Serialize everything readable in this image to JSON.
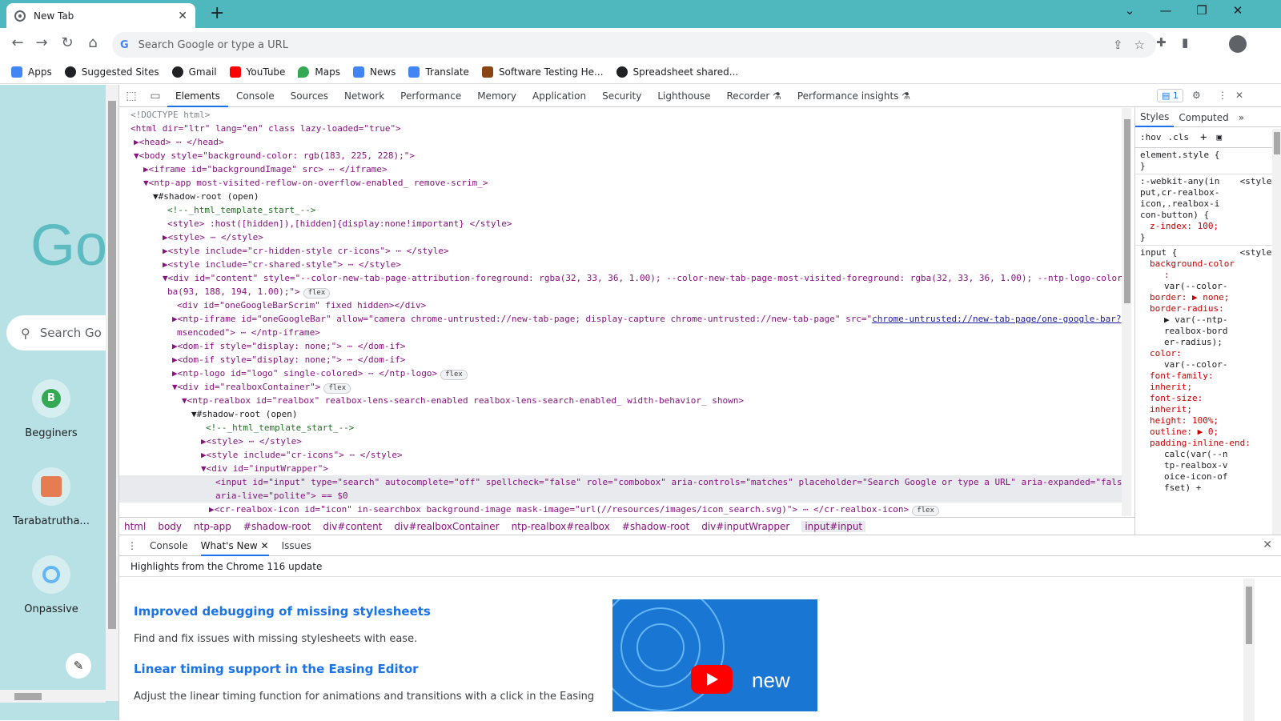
{
  "browser": {
    "tab_title": "New Tab",
    "omnibox_placeholder": "Search Google or type a URL",
    "bookmarks": [
      {
        "label": "Apps",
        "icon": "apps-grid-icon",
        "color": "#4285f4"
      },
      {
        "label": "Suggested Sites",
        "icon": "globe-icon",
        "color": "#202124"
      },
      {
        "label": "Gmail",
        "icon": "globe-icon",
        "color": "#202124"
      },
      {
        "label": "YouTube",
        "icon": "youtube-icon",
        "color": "#ff0000"
      },
      {
        "label": "Maps",
        "icon": "maps-pin-icon",
        "color": "#34a853"
      },
      {
        "label": "News",
        "icon": "news-icon",
        "color": "#4285f4"
      },
      {
        "label": "Translate",
        "icon": "translate-icon",
        "color": "#4285f4"
      },
      {
        "label": "Software Testing He...",
        "icon": "site-icon",
        "color": "#8b4513"
      },
      {
        "label": "Spreadsheet shared...",
        "icon": "globe-icon",
        "color": "#202124"
      }
    ]
  },
  "ntp": {
    "logo_fragment": "Go",
    "search_placeholder": "Search Go",
    "tiles": [
      {
        "label": "Begginers",
        "icon_letter": "B",
        "color": "#34a853"
      },
      {
        "label": "Tarabatrutha...",
        "icon_letter": "",
        "color": "#e67c52"
      },
      {
        "label": "Onpassive",
        "icon_letter": "",
        "color": "#64b5f6"
      }
    ]
  },
  "devtools": {
    "tabs": [
      "Elements",
      "Console",
      "Sources",
      "Network",
      "Performance",
      "Memory",
      "Application",
      "Security",
      "Lighthouse",
      "Recorder ⚗",
      "Performance insights ⚗"
    ],
    "issues_count": "1",
    "dom_lines": [
      {
        "text": "<!DOCTYPE html>"
      },
      {
        "text": "<html dir=\"ltr\" lang=\"en\" class lazy-loaded=\"true\">"
      },
      {
        "text": "▶<head> ⋯ </head>"
      },
      {
        "text": "▼<body style=\"background-color: rgb(183, 225, 228);\">"
      },
      {
        "text": "▶<iframe id=\"backgroundImage\" src> ⋯ </iframe>"
      },
      {
        "text": "▼<ntp-app most-visited-reflow-on-overflow-enabled_ remove-scrim_>"
      },
      {
        "text": "▼#shadow-root (open)"
      },
      {
        "text": "<!--_html_template_start_-->"
      },
      {
        "text": "<style> :host([hidden]),[hidden]{display:none!important} </style>"
      },
      {
        "text": "▶<style> ⋯ </style>"
      },
      {
        "text": "▶<style include=\"cr-hidden-style cr-icons\"> ⋯ </style>"
      },
      {
        "text": "▶<style include=\"cr-shared-style\"> ⋯ </style>"
      },
      {
        "text": "▼<div id=\"content\" style=\"--color-new-tab-page-attribution-foreground: rgba(32, 33, 36, 1.00); --color-new-tab-page-most-visited-foreground: rgba(32, 33, 36, 1.00); --ntp-logo-color: rg"
      },
      {
        "text": "ba(93, 188, 194, 1.00);\">"
      },
      {
        "text": "<div id=\"oneGoogleBarScrim\" fixed hidden></div>"
      },
      {
        "text": "▶<ntp-iframe id=\"oneGoogleBar\" allow=\"camera chrome-untrusted://new-tab-page; display-capture chrome-untrusted://new-tab-page\" src=\""
      },
      {
        "text": "msencoded\"> ⋯ </ntp-iframe>"
      },
      {
        "text": "▶<dom-if style=\"display: none;\"> ⋯ </dom-if>"
      },
      {
        "text": "▶<dom-if style=\"display: none;\"> ⋯ </dom-if>"
      },
      {
        "text": "▶<ntp-logo id=\"logo\" single-colored> ⋯ </ntp-logo>"
      },
      {
        "text": "▼<div id=\"realboxContainer\">"
      },
      {
        "text": "▼<ntp-realbox id=\"realbox\" realbox-lens-search-enabled realbox-lens-search-enabled_ width-behavior_ shown>"
      },
      {
        "text": "▼#shadow-root (open)"
      },
      {
        "text": "<!--_html_template_start_-->"
      },
      {
        "text": "▶<style> ⋯ </style>"
      },
      {
        "text": "▶<style include=\"cr-icons\"> ⋯ </style>"
      },
      {
        "text": "▼<div id=\"inputWrapper\">"
      },
      {
        "text": "<input id=\"input\" type=\"search\" autocomplete=\"off\" spellcheck=\"false\" role=\"combobox\" aria-controls=\"matches\" placeholder=\"Search Google or type a URL\" aria-expanded=\"false\""
      },
      {
        "text": "aria-live=\"polite\"> == $0"
      },
      {
        "text": "▶<cr-realbox-icon id=\"icon\" in-searchbox background-image mask-image=\"url(//resources/images/icon_search.svg)\"> ⋯ </cr-realbox-icon>"
      }
    ],
    "iframe_link": "chrome-untrusted://new-tab-page/one-google-bar?para",
    "flex_badge": "flex",
    "breadcrumbs": [
      "html",
      "body",
      "ntp-app",
      "#shadow-root",
      "div#content",
      "div#realboxContainer",
      "ntp-realbox#realbox",
      "#shadow-root",
      "div#inputWrapper",
      "input#input"
    ],
    "styles": {
      "tabs": [
        "Styles",
        "Computed"
      ],
      "filter_hov": ":hov",
      "filter_cls": ".cls",
      "element_style": "element.style {",
      "close_brace": "}",
      "rule1_selector": ":-webkit-any(input,cr-realbox-icon,.realbox-icon-button) {",
      "rule1_source": "<style>",
      "rule1_prop": "z-index: 100;",
      "rule2_selector": "input {",
      "rule2_source": "<style>",
      "rule2_props": [
        "background-color",
        ":",
        "var(--color-",
        "border: ▶ none;",
        "border-radius:",
        "▶ var(--ntp-realbox-border-radius);",
        "color:",
        "var(--color-",
        "font-family: inherit;",
        "font-size: inherit;",
        "height: 100%;",
        "outline: ▶ 0;",
        "padding-inline-end:",
        "calc(var(--ntp-realbox-voice-icon-offset) +"
      ]
    },
    "drawer": {
      "tabs": [
        "Console",
        "What's New",
        "Issues"
      ],
      "active_tab": "What's New",
      "highlights": "Highlights from the Chrome 116 update",
      "items": [
        {
          "heading": "Improved debugging of missing stylesheets",
          "text": "Find and fix issues with missing stylesheets with ease."
        },
        {
          "heading": "Linear timing support in the Easing Editor",
          "text": "Adjust the linear timing function for animations and transitions with a click in the Easing"
        }
      ],
      "video_label": "new"
    }
  }
}
